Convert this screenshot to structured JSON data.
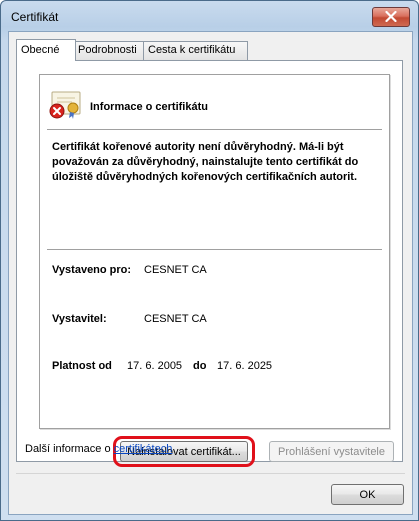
{
  "window": {
    "title": "Certifikát"
  },
  "tabs": [
    {
      "label": "Obecné",
      "active": true
    },
    {
      "label": "Podrobnosti",
      "active": false
    },
    {
      "label": "Cesta k certifikátu",
      "active": false
    }
  ],
  "cert": {
    "heading": "Informace o certifikátu",
    "warning": "Certifikát kořenové autority není důvěryhodný. Má-li být považován za důvěryhodný, nainstalujte tento certifikát do úložiště důvěryhodných kořenových certifikačních autorit.",
    "issued_to_label": "Vystaveno pro:",
    "issued_to_value": "CESNET CA",
    "issuer_label": "Vystavitel:",
    "issuer_value": "CESNET CA",
    "validity_label": "Platnost od",
    "valid_from": "17. 6. 2005",
    "validity_to_label": "do",
    "valid_to": "17. 6. 2025"
  },
  "buttons": {
    "install": "Nainstalovat certifikát...",
    "issuer_statement": "Prohlášení vystavitele",
    "ok": "OK"
  },
  "more_info": {
    "prefix": "Další informace o",
    "link": "certifikátech"
  },
  "icons": {
    "close": "close-icon",
    "certificate": "certificate-error-icon"
  },
  "colors": {
    "highlight": "#e0101a",
    "link": "#0a47c0"
  }
}
